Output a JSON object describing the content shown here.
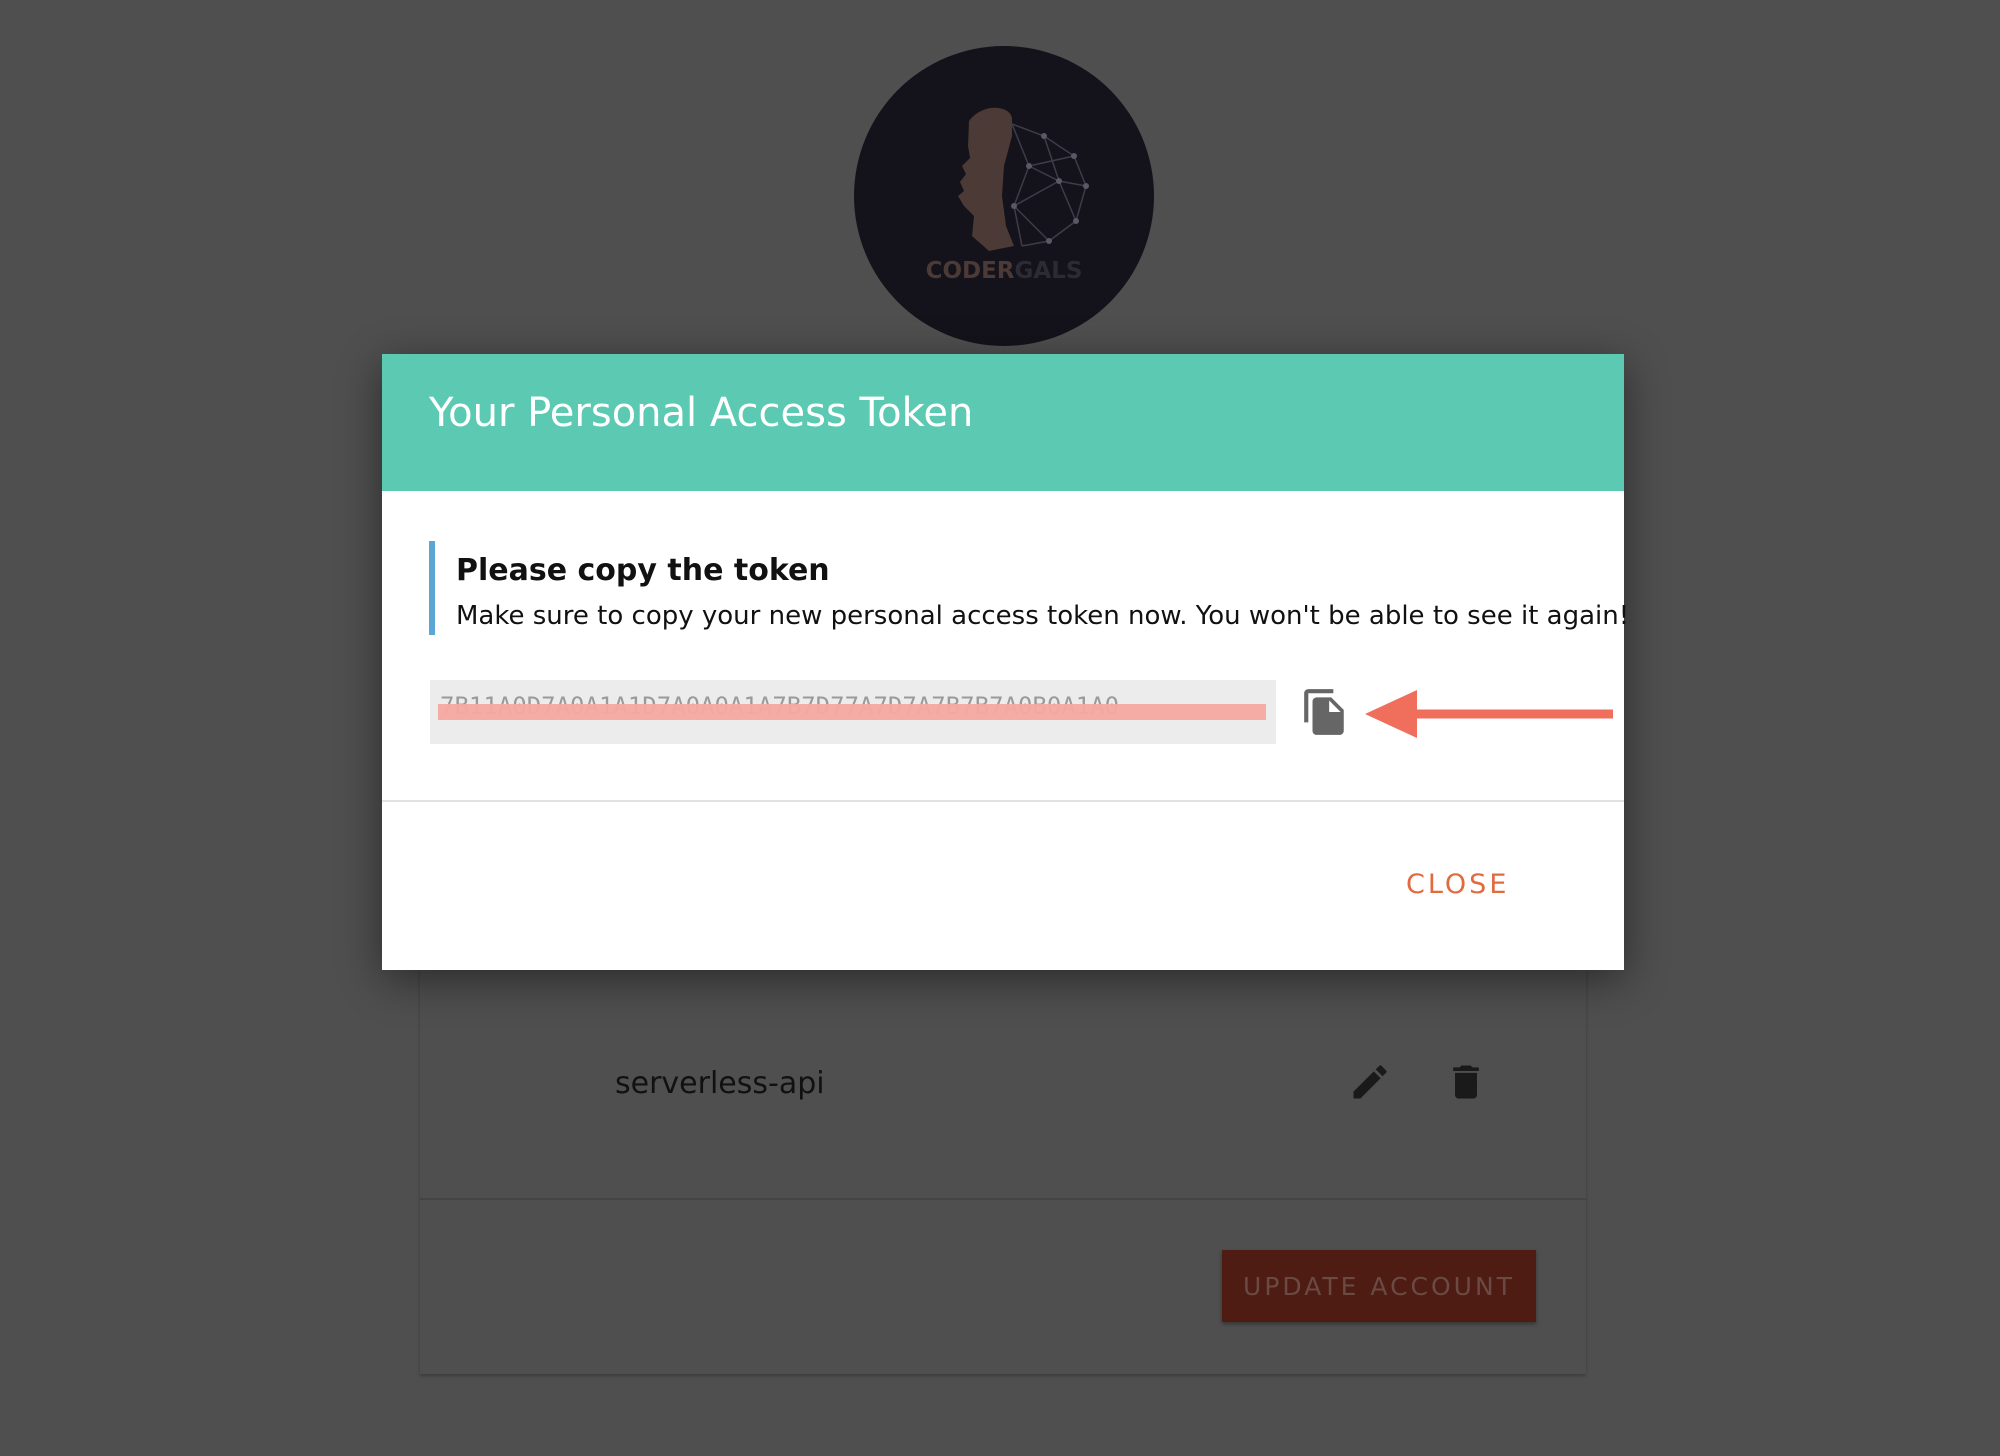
{
  "background": {
    "avatar": {
      "logo_text_part1": "CODER",
      "logo_text_part2": "GALS"
    },
    "app_item": {
      "name": "serverless-api",
      "edit_icon": "pencil-icon",
      "delete_icon": "trash-icon"
    },
    "update_button_label": "UPDATE ACCOUNT"
  },
  "modal": {
    "title": "Your Personal Access Token",
    "notice": {
      "title": "Please copy the token",
      "body": "Make sure to copy your new personal access token now. You won't be able to see it again!"
    },
    "token_value": "7B11A0D7A0A1A1D7A0A0A1A7B7D77A7D7A7B7B7A0B0A1A0",
    "copy_icon": "copy-icon",
    "close_label": "CLOSE"
  },
  "colors": {
    "header_bg": "#5ccab3",
    "notice_accent": "#5aa6d4",
    "close_text": "#e16a3f",
    "annotation_arrow": "#ef6f5c",
    "overlay_bg": "#4f4f4f"
  }
}
